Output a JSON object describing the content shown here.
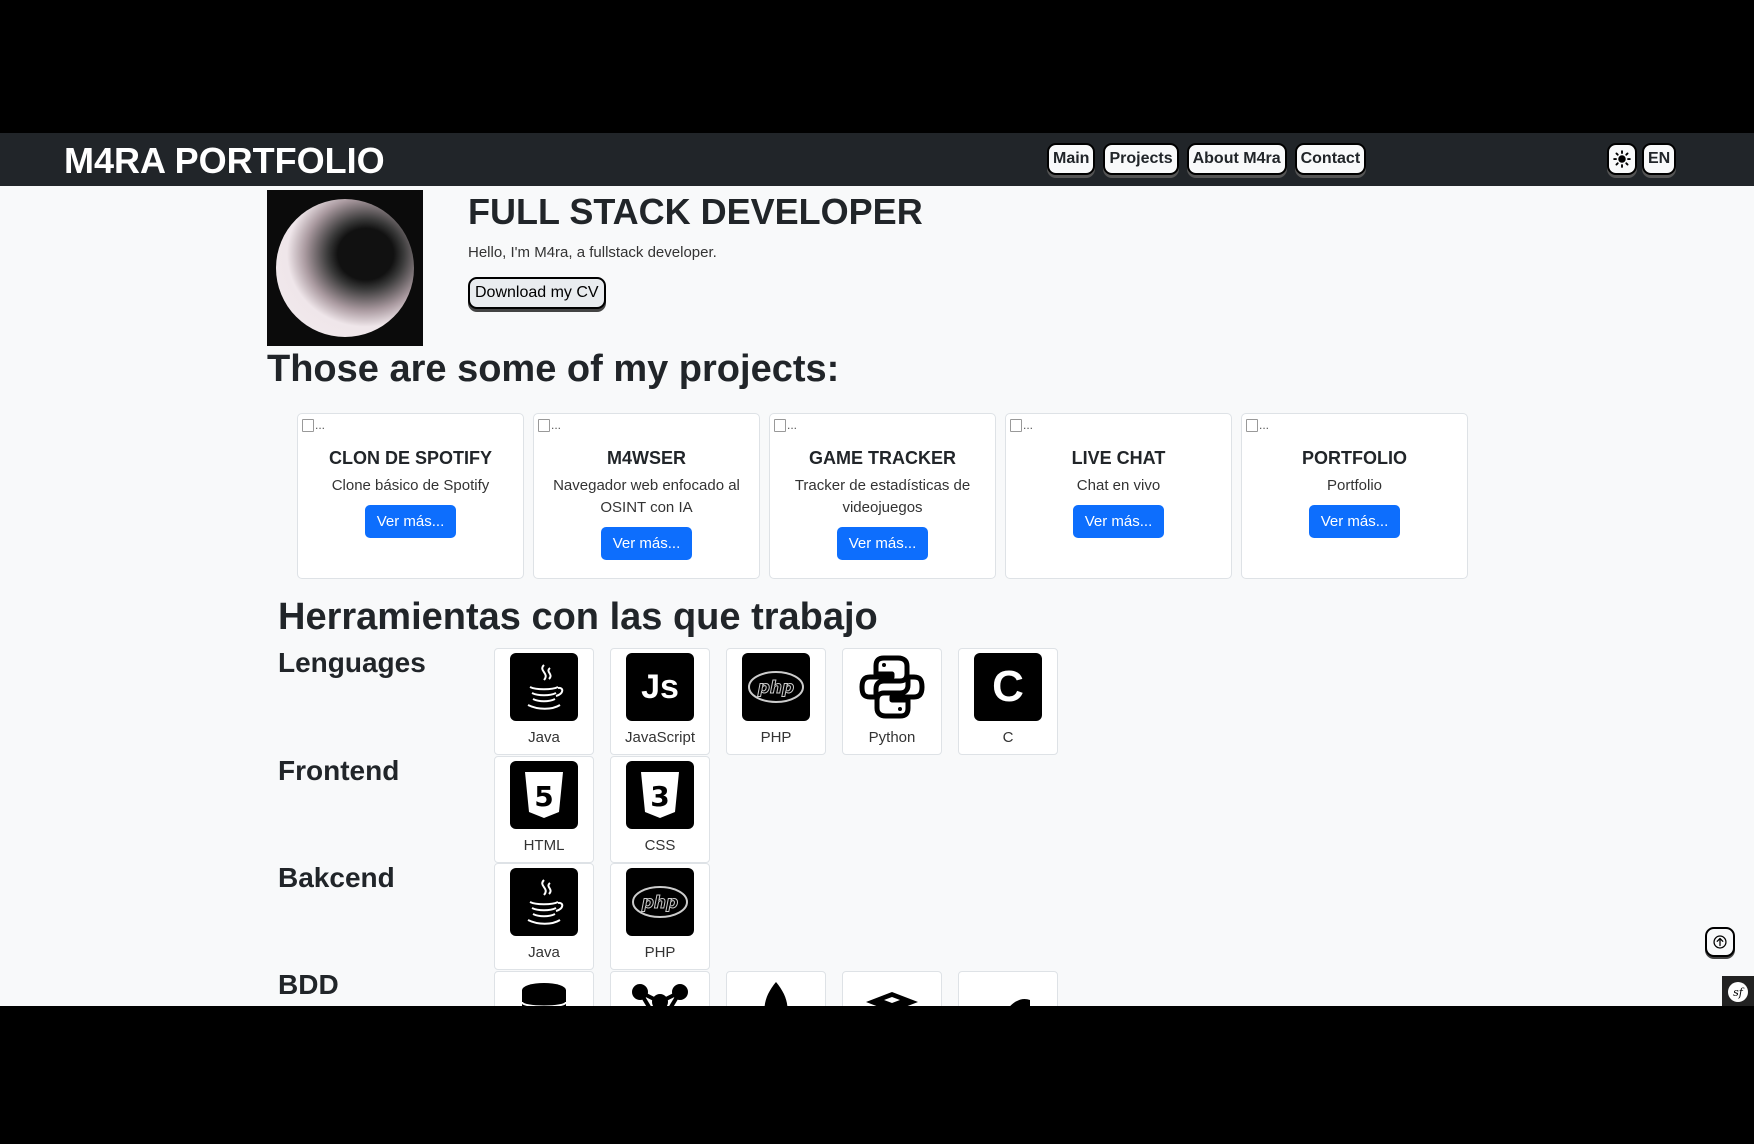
{
  "navbar": {
    "brand": "M4RA PORTFOLIO",
    "links": [
      {
        "label": "Main"
      },
      {
        "label": "Projects"
      },
      {
        "label": "About M4ra"
      },
      {
        "label": "Contact"
      }
    ],
    "language": "EN",
    "theme_icon": "sun-icon"
  },
  "hero": {
    "title": "FULL STACK DEVELOPER",
    "subtitle": "Hello, I'm M4ra, a fullstack developer.",
    "cv_button": "Download my CV"
  },
  "projects": {
    "heading": "Those are some of my projects:",
    "image_alt": "...",
    "items": [
      {
        "title": "CLON DE SPOTIFY",
        "description": "Clone básico de Spotify",
        "button": "Ver más..."
      },
      {
        "title": "M4WSER",
        "description": "Navegador web enfocado al OSINT con IA",
        "button": "Ver más..."
      },
      {
        "title": "GAME TRACKER",
        "description": "Tracker de estadísticas de videojuegos",
        "button": "Ver más..."
      },
      {
        "title": "LIVE CHAT",
        "description": "Chat en vivo",
        "button": "Ver más..."
      },
      {
        "title": "PORTFOLIO",
        "description": "Portfolio",
        "button": "Ver más..."
      }
    ]
  },
  "tools": {
    "heading": "Herramientas con las que trabajo",
    "groups": [
      {
        "label": "Lenguages",
        "items": [
          {
            "name": "Java",
            "icon": "java-icon"
          },
          {
            "name": "JavaScript",
            "icon": "javascript-icon"
          },
          {
            "name": "PHP",
            "icon": "php-icon"
          },
          {
            "name": "Python",
            "icon": "python-icon"
          },
          {
            "name": "C",
            "icon": "c-icon"
          }
        ]
      },
      {
        "label": "Frontend",
        "items": [
          {
            "name": "HTML",
            "icon": "html5-icon"
          },
          {
            "name": "CSS",
            "icon": "css3-icon"
          }
        ]
      },
      {
        "label": "Bakcend",
        "items": [
          {
            "name": "Java",
            "icon": "java-icon"
          },
          {
            "name": "PHP",
            "icon": "php-icon"
          }
        ]
      },
      {
        "label": "BDD",
        "items": [
          {
            "icon": "database-icon"
          },
          {
            "icon": "graph-database-icon"
          },
          {
            "icon": "mongodb-leaf-icon"
          },
          {
            "icon": "redis-icon"
          },
          {
            "icon": "mysql-dolphin-icon"
          }
        ]
      }
    ]
  },
  "widgets": {
    "scroll_top_icon": "arrow-up-icon",
    "symfony_icon": "symfony-icon"
  }
}
